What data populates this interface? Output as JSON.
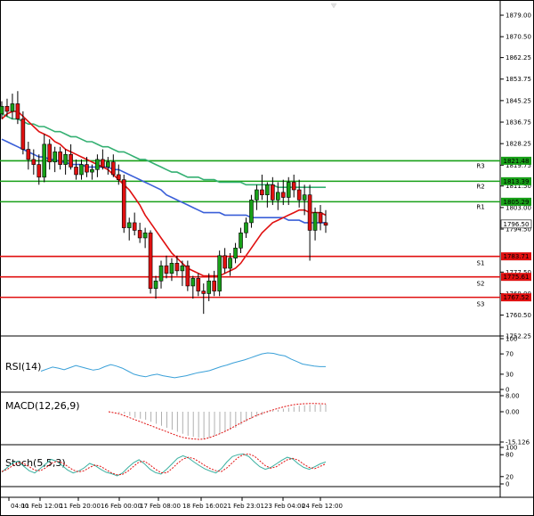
{
  "chart_data": {
    "type": "candlestick",
    "main": {
      "ylim": [
        1752.25,
        1885.0
      ],
      "y_ticks": [
        "1879.00",
        "1870.50",
        "1862.25",
        "1853.75",
        "1845.25",
        "1836.75",
        "1828.25",
        "1819.75",
        "1811.50",
        "1803.00",
        "1794.50",
        "1777.50",
        "1769.00",
        "1760.50",
        "1752.25"
      ],
      "price_tag": "1796.50",
      "levels": [
        {
          "name": "R3",
          "value": 1821.48,
          "label": "1821.48",
          "color": "#18a018"
        },
        {
          "name": "R2",
          "value": 1813.39,
          "label": "1813.39",
          "color": "#18a018"
        },
        {
          "name": "R1",
          "value": 1805.29,
          "label": "1805.29",
          "color": "#18a018"
        },
        {
          "name": "S1",
          "value": 1783.71,
          "label": "1783.71",
          "color": "#e01010"
        },
        {
          "name": "S2",
          "value": 1775.61,
          "label": "1775.61",
          "color": "#e01010"
        },
        {
          "name": "S3",
          "value": 1767.52,
          "label": "1767.52",
          "color": "#e01010"
        }
      ],
      "candles": [
        [
          1840,
          1845,
          1838,
          1843
        ],
        [
          1843,
          1846,
          1839,
          1841
        ],
        [
          1841,
          1848,
          1838,
          1844
        ],
        [
          1844,
          1849,
          1836,
          1838
        ],
        [
          1838,
          1841,
          1824,
          1826
        ],
        [
          1826,
          1829,
          1818,
          1822
        ],
        [
          1822,
          1826,
          1816,
          1820
        ],
        [
          1820,
          1824,
          1812,
          1815
        ],
        [
          1815,
          1832,
          1813,
          1828
        ],
        [
          1828,
          1830,
          1818,
          1821
        ],
        [
          1821,
          1827,
          1817,
          1825
        ],
        [
          1825,
          1827,
          1818,
          1820
        ],
        [
          1820,
          1826,
          1816,
          1824
        ],
        [
          1824,
          1828,
          1818,
          1819
        ],
        [
          1819,
          1822,
          1814,
          1816
        ],
        [
          1816,
          1822,
          1814,
          1820
        ],
        [
          1820,
          1823,
          1815,
          1817
        ],
        [
          1817,
          1820,
          1814,
          1818
        ],
        [
          1818,
          1824,
          1815,
          1822
        ],
        [
          1822,
          1826,
          1818,
          1819
        ],
        [
          1819,
          1823,
          1816,
          1821
        ],
        [
          1821,
          1824,
          1815,
          1816
        ],
        [
          1816,
          1820,
          1812,
          1814
        ],
        [
          1814,
          1816,
          1793,
          1795
        ],
        [
          1795,
          1799,
          1790,
          1797
        ],
        [
          1797,
          1801,
          1792,
          1794
        ],
        [
          1794,
          1797,
          1789,
          1791
        ],
        [
          1791,
          1795,
          1787,
          1793
        ],
        [
          1793,
          1794,
          1769,
          1771
        ],
        [
          1771,
          1776,
          1767,
          1774
        ],
        [
          1774,
          1782,
          1771,
          1780
        ],
        [
          1780,
          1784,
          1775,
          1777
        ],
        [
          1777,
          1783,
          1774,
          1781
        ],
        [
          1781,
          1784,
          1776,
          1778
        ],
        [
          1778,
          1782,
          1772,
          1780
        ],
        [
          1780,
          1782,
          1770,
          1772
        ],
        [
          1772,
          1776,
          1767,
          1775
        ],
        [
          1775,
          1777,
          1768,
          1770
        ],
        [
          1770,
          1773,
          1761,
          1769
        ],
        [
          1769,
          1777,
          1766,
          1774
        ],
        [
          1774,
          1778,
          1768,
          1770
        ],
        [
          1770,
          1786,
          1768,
          1784
        ],
        [
          1784,
          1787,
          1777,
          1779
        ],
        [
          1779,
          1785,
          1776,
          1783
        ],
        [
          1783,
          1789,
          1781,
          1787
        ],
        [
          1787,
          1795,
          1785,
          1793
        ],
        [
          1793,
          1799,
          1791,
          1797
        ],
        [
          1797,
          1808,
          1795,
          1806
        ],
        [
          1806,
          1812,
          1802,
          1810
        ],
        [
          1810,
          1816,
          1806,
          1808
        ],
        [
          1808,
          1813,
          1803,
          1812
        ],
        [
          1812,
          1815,
          1804,
          1806
        ],
        [
          1806,
          1813,
          1802,
          1809
        ],
        [
          1809,
          1814,
          1804,
          1807
        ],
        [
          1807,
          1815,
          1804,
          1813
        ],
        [
          1813,
          1816,
          1807,
          1810
        ],
        [
          1810,
          1814,
          1803,
          1806
        ],
        [
          1806,
          1812,
          1800,
          1808
        ],
        [
          1808,
          1812,
          1782,
          1794
        ],
        [
          1794,
          1803,
          1790,
          1801
        ],
        [
          1801,
          1804,
          1794,
          1797
        ],
        [
          1797,
          1802,
          1793,
          1796
        ]
      ],
      "ma_red": [
        1838,
        1840,
        1841,
        1841,
        1839,
        1837,
        1835,
        1833,
        1832,
        1831,
        1829,
        1828,
        1826,
        1825,
        1824,
        1823,
        1822,
        1821,
        1820,
        1819,
        1818,
        1816,
        1814,
        1812,
        1810,
        1807,
        1804,
        1800,
        1797,
        1794,
        1791,
        1788,
        1785,
        1783,
        1781,
        1779,
        1778,
        1777,
        1776,
        1776,
        1776,
        1776,
        1777,
        1778,
        1779,
        1781,
        1784,
        1787,
        1790,
        1793,
        1795,
        1797,
        1798,
        1799,
        1800,
        1801,
        1802,
        1802,
        1801,
        1801,
        1801,
        1800
      ],
      "ma_blue": [
        1830,
        1829,
        1828,
        1827,
        1826,
        1825,
        1824,
        1823,
        1823,
        1822,
        1822,
        1821,
        1821,
        1820,
        1820,
        1820,
        1819,
        1819,
        1819,
        1819,
        1819,
        1818,
        1818,
        1817,
        1816,
        1815,
        1814,
        1813,
        1812,
        1811,
        1810,
        1808,
        1807,
        1806,
        1805,
        1804,
        1803,
        1802,
        1801,
        1801,
        1801,
        1801,
        1800,
        1800,
        1800,
        1800,
        1800,
        1799,
        1799,
        1799,
        1799,
        1799,
        1799,
        1799,
        1798,
        1798,
        1798,
        1797,
        1797,
        1797,
        1797,
        1797
      ],
      "ma_green": [
        1840,
        1839,
        1838,
        1838,
        1837,
        1836,
        1836,
        1835,
        1835,
        1834,
        1833,
        1833,
        1832,
        1831,
        1831,
        1830,
        1829,
        1829,
        1828,
        1827,
        1827,
        1826,
        1825,
        1825,
        1824,
        1823,
        1822,
        1822,
        1821,
        1820,
        1819,
        1818,
        1817,
        1817,
        1816,
        1815,
        1815,
        1815,
        1814,
        1814,
        1814,
        1813,
        1813,
        1813,
        1813,
        1813,
        1812,
        1812,
        1812,
        1812,
        1812,
        1812,
        1811,
        1811,
        1811,
        1811,
        1811,
        1811,
        1811,
        1811,
        1811,
        1811
      ]
    },
    "rsi": {
      "label": "RSI(14)",
      "y_ticks": [
        "100",
        "70",
        "30",
        "0"
      ],
      "ylim": [
        0,
        100
      ],
      "values": [
        36,
        40,
        44,
        42,
        39,
        43,
        47,
        44,
        41,
        38,
        40,
        45,
        49,
        46,
        42,
        36,
        30,
        27,
        25,
        28,
        30,
        27,
        25,
        23,
        25,
        27,
        30,
        33,
        35,
        37,
        41,
        45,
        48,
        52,
        55,
        58,
        62,
        66,
        70,
        72,
        71,
        68,
        66,
        60,
        55,
        50,
        48,
        46,
        45,
        45
      ]
    },
    "macd": {
      "label": "MACD(12,26,9)",
      "y_ticks": [
        "8.00",
        "0.00",
        "-15.126"
      ],
      "ylim": [
        -15.126,
        8.0
      ],
      "histogram": [
        0,
        0,
        -0.5,
        -1,
        -2,
        -3,
        -3.5,
        -4,
        -5,
        -6,
        -7,
        -8,
        -9,
        -10,
        -11,
        -12,
        -12.5,
        -13,
        -13.5,
        -13,
        -12,
        -11,
        -10,
        -9,
        -8,
        -6.5,
        -5,
        -3.5,
        -2.5,
        -1.5,
        -0.5,
        0.5,
        1,
        1.5,
        2,
        2.5,
        3,
        3.2,
        3.4,
        3.5,
        3.6,
        3.7
      ],
      "signal": [
        0,
        -0.5,
        -1,
        -2,
        -3,
        -4,
        -5,
        -6,
        -7,
        -8,
        -9,
        -10,
        -11,
        -12,
        -12.8,
        -13.3,
        -13.6,
        -13.8,
        -13.6,
        -13.0,
        -12.0,
        -11.0,
        -9.8,
        -8.4,
        -7.0,
        -5.6,
        -4.2,
        -3.0,
        -1.8,
        -0.8,
        0.1,
        0.9,
        1.7,
        2.4,
        3.0,
        3.5,
        3.8,
        4.0,
        4.1,
        4.1,
        4.0,
        3.9
      ]
    },
    "stoch": {
      "label": "Stoch(5,5,3)",
      "y_ticks": [
        "100",
        "80",
        "20",
        "0"
      ],
      "ylim": [
        0,
        100
      ],
      "main": [
        32,
        45,
        58,
        62,
        48,
        36,
        30,
        42,
        55,
        67,
        62,
        50,
        38,
        30,
        35,
        44,
        56,
        50,
        40,
        32,
        28,
        22,
        30,
        45,
        58,
        66,
        55,
        40,
        31,
        27,
        40,
        55,
        70,
        77,
        71,
        60,
        50,
        41,
        35,
        30,
        42,
        60,
        75,
        80,
        82,
        75,
        60,
        47,
        40,
        45,
        55,
        65,
        73,
        68,
        55,
        45,
        40,
        47,
        55,
        60
      ],
      "signal": [
        34,
        40,
        50,
        58,
        56,
        47,
        38,
        36,
        44,
        56,
        62,
        58,
        48,
        38,
        33,
        36,
        45,
        52,
        48,
        39,
        30,
        25,
        26,
        35,
        48,
        60,
        62,
        52,
        40,
        31,
        30,
        42,
        56,
        68,
        73,
        69,
        60,
        50,
        42,
        36,
        34,
        44,
        58,
        72,
        80,
        82,
        76,
        63,
        50,
        43,
        47,
        57,
        66,
        70,
        65,
        54,
        45,
        42,
        48,
        55
      ]
    },
    "x_ticks": [
      "04:00",
      "11 Feb 12:00",
      "11 Feb 20:00",
      "16 Feb 00:00",
      "17 Feb 08:00",
      "18 Feb 16:00",
      "21 Feb 23:01",
      "23 Feb 04:00",
      "24 Feb 12:00"
    ],
    "colors": {
      "bull": "#18a018",
      "bear": "#e01010",
      "ma_red": "#e01010",
      "ma_blue": "#3a5fd8",
      "ma_green": "#34b072",
      "rsi": "#3aa0d8",
      "stoch_main": "#3ab0a0",
      "stoch_signal": "#e01010",
      "macd_hist": "#b0b0b0"
    }
  }
}
